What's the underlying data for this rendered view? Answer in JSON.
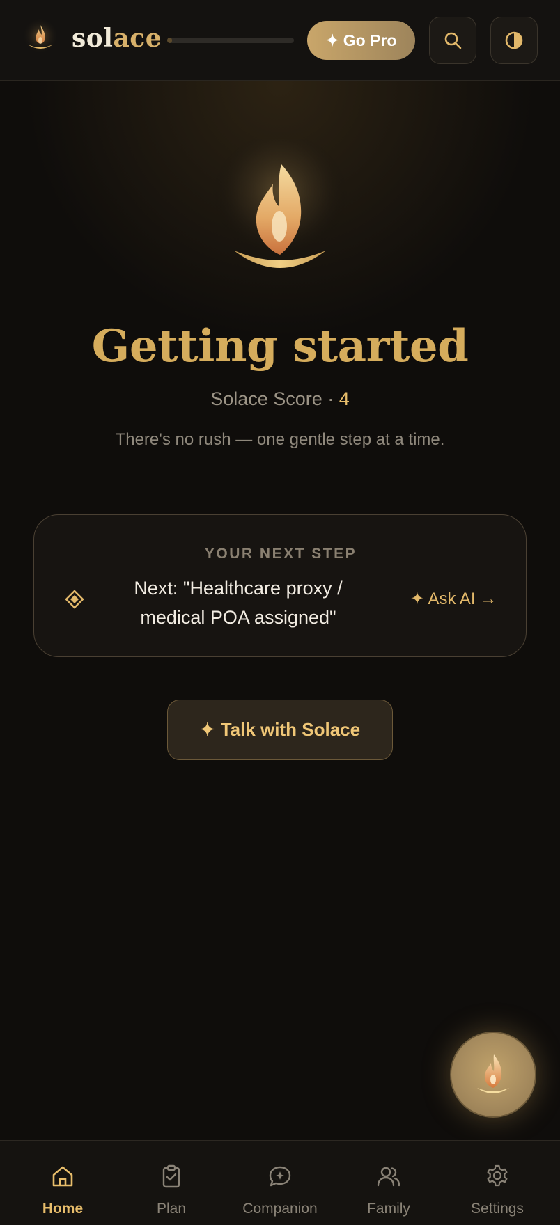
{
  "header": {
    "brand_prefix": "sol",
    "brand_suffix": "ace",
    "progress_fraction": 0.04,
    "go_pro_label": "Go Pro",
    "search_icon": "search-icon",
    "theme_icon": "contrast-icon"
  },
  "hero": {
    "title": "Getting started",
    "score_label": "Solace Score · ",
    "score_value": "4",
    "subtitle": "There's no rush — one gentle step at a time."
  },
  "next_step": {
    "eyebrow": "YOUR NEXT STEP",
    "text": "Next: \"Healthcare proxy / medical POA assigned\"",
    "ask_ai_label": "✦ Ask AI →"
  },
  "talk_button": {
    "label": "Talk with Solace"
  },
  "nav": {
    "items": [
      {
        "label": "Home",
        "icon": "home-icon",
        "active": true
      },
      {
        "label": "Plan",
        "icon": "clipboard-check-icon",
        "active": false
      },
      {
        "label": "Companion",
        "icon": "chat-sparkle-icon",
        "active": false
      },
      {
        "label": "Family",
        "icon": "users-icon",
        "active": false
      },
      {
        "label": "Settings",
        "icon": "gear-icon",
        "active": false
      }
    ]
  },
  "colors": {
    "accent_gold": "#d5ac5c",
    "background": "#0f0d0b",
    "muted_text": "#8f887c"
  }
}
